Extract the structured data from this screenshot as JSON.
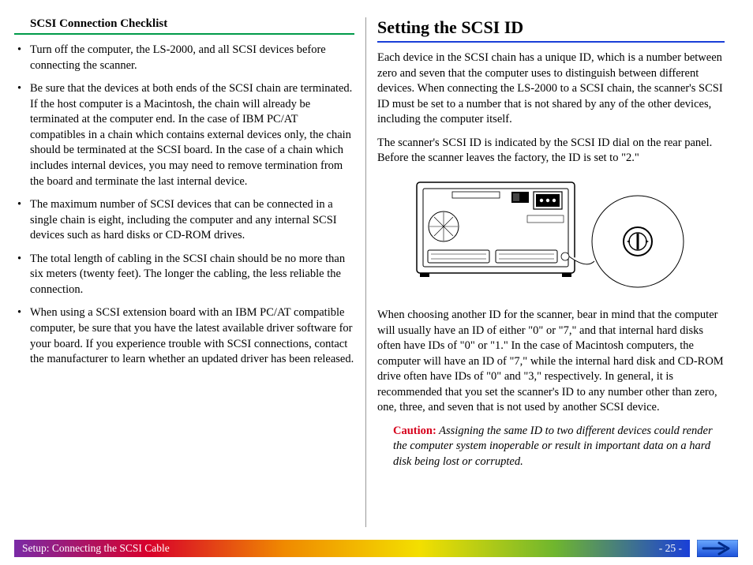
{
  "left": {
    "checklist_title": "SCSI Connection Checklist",
    "items": [
      "Turn off the computer, the LS-2000, and all SCSI devices before connecting the scanner.",
      "Be sure that the devices at both ends of the SCSI chain are terminated.  If the host computer is a Macintosh, the chain will already be terminated at the computer end.  In the case of IBM PC/AT compatibles in a chain which contains external devices only, the chain should be terminated at the SCSI board.  In the case of a chain which includes internal devices, you may need to remove termination from the board and terminate the last internal device.",
      "The maximum number of SCSI devices that can be connected in a single chain is eight, including the computer and any internal SCSI devices such as hard disks or CD-ROM drives.",
      "The total length of cabling in the SCSI chain should be no more than six meters (twenty feet).  The longer the cabling, the less reliable the connection.",
      "When using a SCSI extension board with an IBM PC/AT compatible computer, be sure that you have the latest available driver software for your board.  If you experience trouble with SCSI connections, contact the manufacturer to learn whether an updated driver has been released."
    ]
  },
  "right": {
    "heading": "Setting the SCSI ID",
    "p1": "Each device in the SCSI chain has a unique ID, which is a number between zero and seven that the computer uses to distinguish between different devices.  When connecting the LS-2000 to a SCSI chain, the scanner's SCSI ID must be set to a number that is not shared by any of the other devices, including the computer itself.",
    "p2": "The scanner's SCSI ID is indicated by the SCSI ID dial on the rear panel.  Before the scanner leaves the factory, the ID is set to \"2.\"",
    "p3": "When choosing another ID for the scanner, bear in mind that the computer will usually have an ID of either \"0\" or \"7,\" and that internal hard disks often have IDs of \"0\" or \"1.\"  In the case of Macintosh computers, the computer will have an ID of \"7,\" while the internal hard disk and CD-ROM drive often have IDs of \"0\" and \"3,\" respectively.  In general, it is recommended that you set the scanner's ID to any number other than zero, one, three, and seven that is not used by another SCSI device.",
    "caution_label": "Caution:",
    "caution_text": "  Assigning the same ID to two different devices could render the computer system inoperable or result in important data on a hard disk being lost or corrupted."
  },
  "footer": {
    "section": "Setup:  Connecting the SCSI Cable",
    "page": "- 25 -"
  }
}
